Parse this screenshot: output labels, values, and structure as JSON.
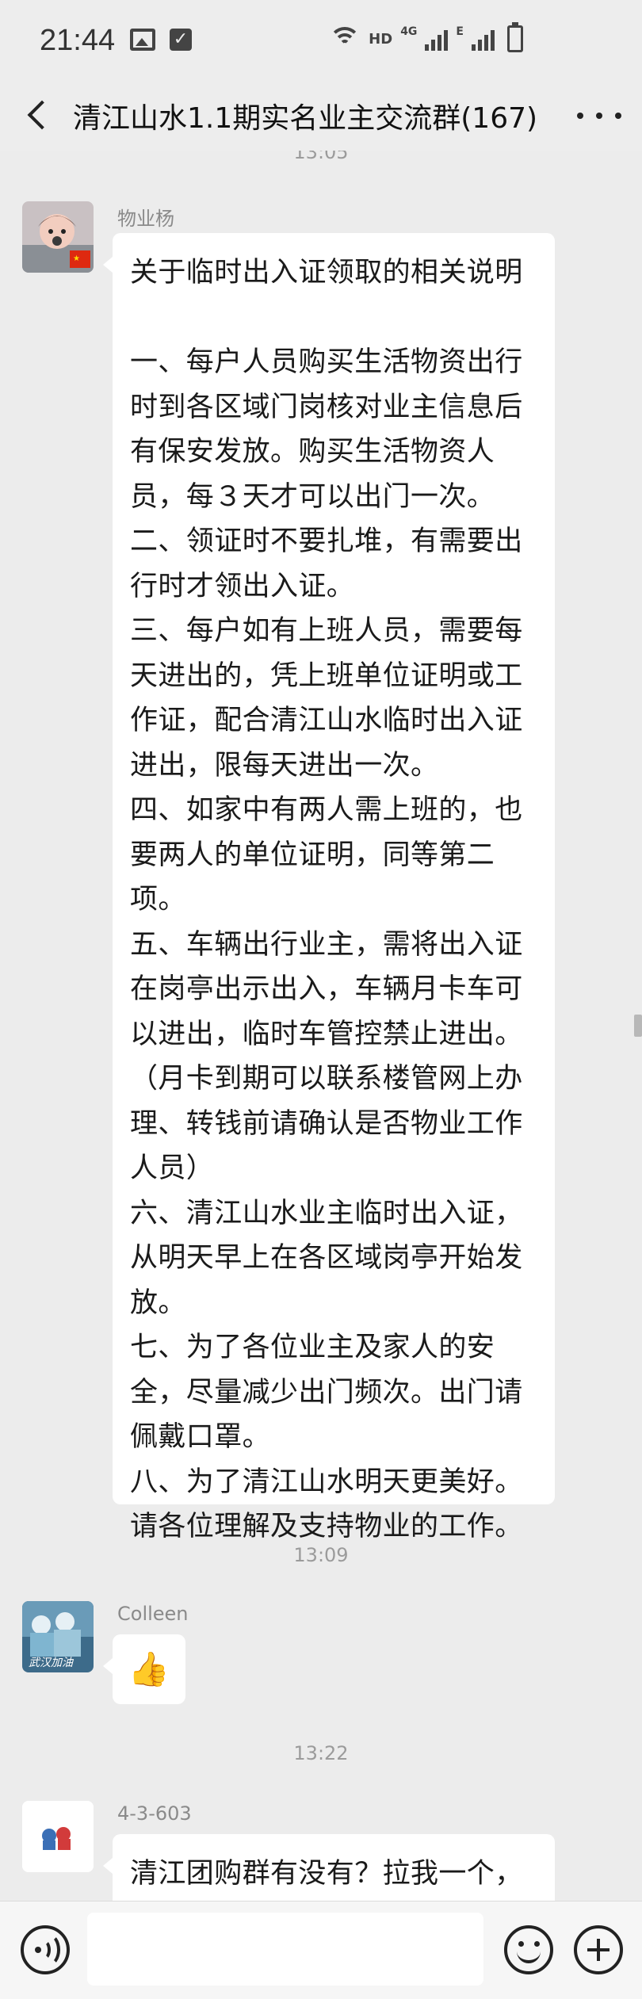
{
  "status_bar": {
    "time": "21:44",
    "network_labels": [
      "HD",
      "4G",
      "E"
    ]
  },
  "header": {
    "title": "清江山水1.1期实名业主交流群(167)"
  },
  "chat": {
    "top_timestamp": "13:05",
    "messages": [
      {
        "sender": "物业杨",
        "avatar": "child-photo-avatar",
        "lines": [
          "关于临时出入证领取的相关说明",
          "",
          "一、每户人员购买生活物资出行",
          "时到各区域门岗核对业主信息后",
          "有保安发放。购买生活物资人",
          "员，每３天才可以出门一次。",
          "二、领证时不要扎堆，有需要出",
          "行时才领出入证。",
          "三、每户如有上班人员，需要每",
          "天进出的，凭上班单位证明或工",
          "作证，配合清江山水临时出入证",
          "进出，限每天进出一次。",
          "四、如家中有两人需上班的，也",
          "要两人的单位证明，同等第二项。",
          "五、车辆出行业主，需将出入证",
          "在岗亭出示出入，车辆月卡车可",
          "以进出，临时车管控禁止进出。",
          "（月卡到期可以联系楼管网上办",
          "理、转钱前请确认是否物业工作",
          "人员）",
          "六、清江山水业主临时出入证，",
          "从明天早上在各区域岗亭开始发",
          "放。",
          "七、为了各位业主及家人的安",
          "全，尽量减少出门频次。出门请",
          "佩戴口罩。",
          "八、为了清江山水明天更美好。",
          "请各位理解及支持物业的工作。"
        ]
      },
      {
        "timestamp": "13:09",
        "sender": "Colleen",
        "avatar": "wuhan-jiayou-avatar",
        "avatar_caption": "武汉加油",
        "emoji": "👍"
      },
      {
        "timestamp": "13:22",
        "sender": "4-3-603",
        "avatar": "cartoon-avatar",
        "text": "清江团购群有没有？拉我一个，"
      }
    ]
  },
  "colors": {
    "background": "#ececec",
    "bubble": "#ffffff",
    "timestamp": "#9b9b9b"
  }
}
